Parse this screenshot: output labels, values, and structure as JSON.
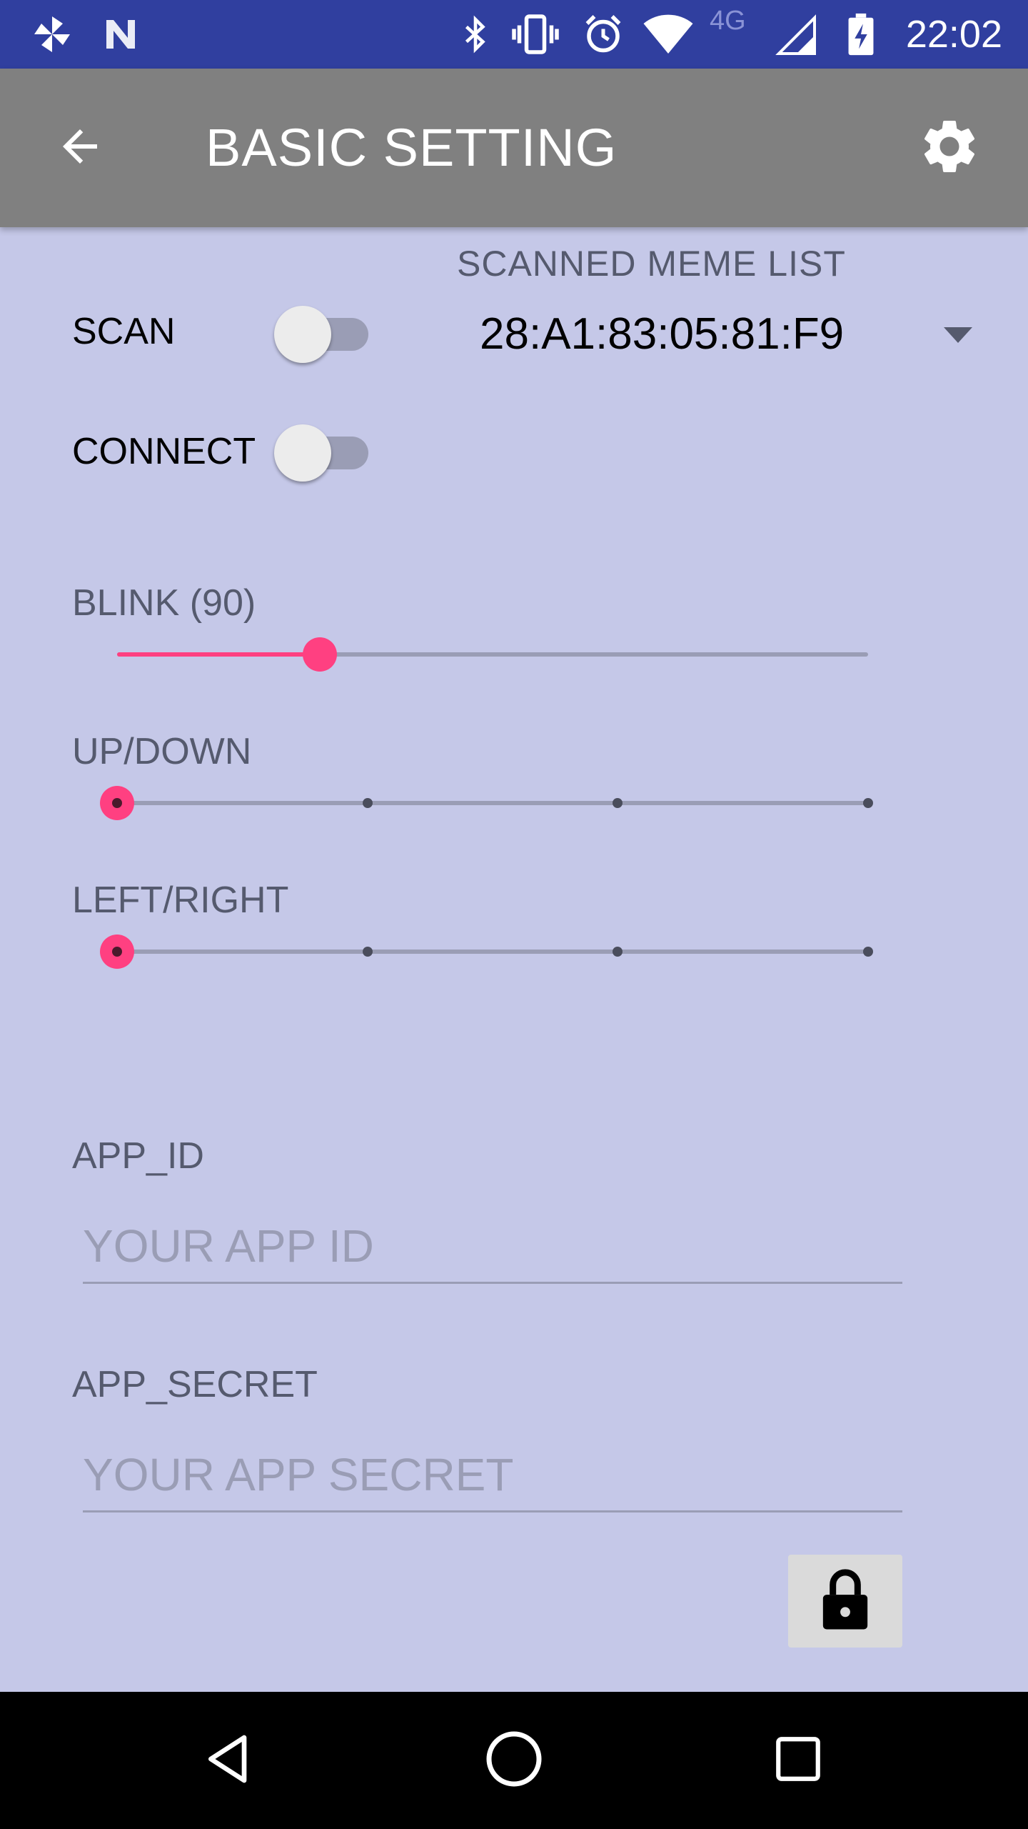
{
  "status_bar": {
    "time": "22:02",
    "network_type": "4G",
    "icons": [
      "pinwheel-icon",
      "n-icon",
      "bluetooth-icon",
      "vibrate-icon",
      "alarm-icon",
      "wifi-icon",
      "cell-signal-icon",
      "battery-charging-icon"
    ]
  },
  "app_bar": {
    "title": "BASIC SETTING",
    "back_icon": "arrow-back-icon",
    "settings_icon": "gear-icon"
  },
  "scan": {
    "label": "SCAN",
    "checked": false
  },
  "connect": {
    "label": "CONNECT",
    "checked": false
  },
  "scanned_list": {
    "label": "SCANNED MEME LIST",
    "selected": "28:A1:83:05:81:F9"
  },
  "blink": {
    "label": "BLINK (90)",
    "fraction": 0.27
  },
  "up_down": {
    "label": "UP/DOWN",
    "steps": 4,
    "selected_step": 0
  },
  "left_right": {
    "label": "LEFT/RIGHT",
    "steps": 4,
    "selected_step": 0
  },
  "app_id": {
    "label": "APP_ID",
    "placeholder": "YOUR APP ID",
    "value": ""
  },
  "app_secret": {
    "label": "APP_SECRET",
    "placeholder": "YOUR APP SECRET",
    "value": ""
  },
  "lock_button": {
    "icon": "lock-icon"
  },
  "nav_bar": {
    "back_icon": "nav-back-icon",
    "home_icon": "nav-home-icon",
    "recents_icon": "nav-recents-icon"
  },
  "colors": {
    "status_bar": "#303f9f",
    "app_bar": "#808080",
    "background": "#c5c8e8",
    "accent": "#ff4081"
  }
}
